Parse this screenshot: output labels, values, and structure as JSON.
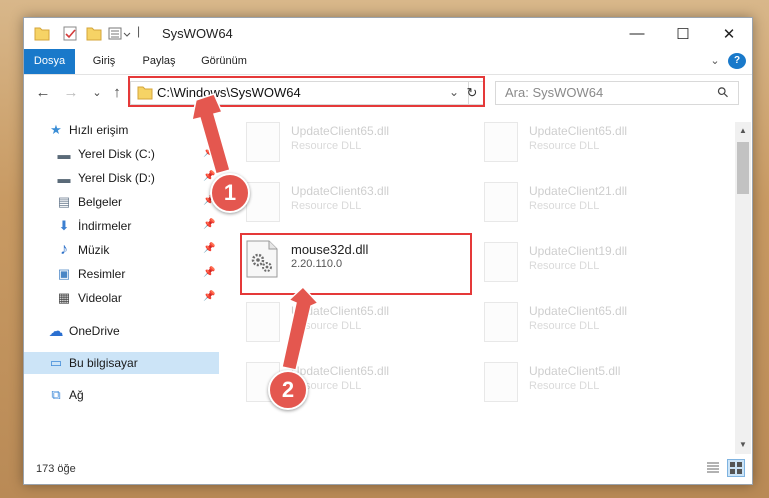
{
  "window": {
    "title": "SysWOW64",
    "minimize_glyph": "—",
    "maximize_glyph": "☐",
    "close_glyph": "✕"
  },
  "ribbon": {
    "tabs": [
      "Dosya",
      "Giriş",
      "Paylaş",
      "Görünüm"
    ],
    "collapse_glyph": "⌄",
    "help_glyph": "?"
  },
  "navigation": {
    "back_glyph": "←",
    "forward_glyph": "→",
    "recent_glyph": "⌄",
    "up_glyph": "↑",
    "address": "C:\\Windows\\SysWOW64",
    "address_dropdown_glyph": "⌄",
    "refresh_glyph": "↻",
    "search_placeholder": "Ara: SysWOW64",
    "search_glyph": "⚲"
  },
  "sidebar": {
    "items": [
      {
        "label": "Hızlı erişim",
        "icon": "star-icon",
        "glyph": "★",
        "color": "#3b8ed6"
      },
      {
        "label": "Yerel Disk (C:)",
        "icon": "drive-icon",
        "glyph": "▬",
        "color": "#5a6a78",
        "pin": "📌"
      },
      {
        "label": "Yerel Disk (D:)",
        "icon": "drive-icon",
        "glyph": "▬",
        "color": "#5a6a78",
        "pin": "📌"
      },
      {
        "label": "Belgeler",
        "icon": "documents-icon",
        "glyph": "▤",
        "color": "#6b7c8f",
        "pin": "📌"
      },
      {
        "label": "İndirmeler",
        "icon": "download-icon",
        "glyph": "⬇",
        "color": "#3b7fd1",
        "pin": "📌"
      },
      {
        "label": "Müzik",
        "icon": "music-icon",
        "glyph": "♪",
        "color": "#2f72c9",
        "pin": "📌"
      },
      {
        "label": "Resimler",
        "icon": "pictures-icon",
        "glyph": "▣",
        "color": "#4a86c5",
        "pin": "📌"
      },
      {
        "label": "Videolar",
        "icon": "videos-icon",
        "glyph": "▦",
        "color": "#444",
        "pin": "📌"
      },
      {
        "label": "OneDrive",
        "icon": "cloud-icon",
        "glyph": "☁",
        "color": "#2a6fd0"
      },
      {
        "label": "Bu bilgisayar",
        "icon": "computer-icon",
        "glyph": "▭",
        "color": "#3d89d8"
      },
      {
        "label": "Ağ",
        "icon": "network-icon",
        "glyph": "⧉",
        "color": "#3d89d8"
      }
    ]
  },
  "files": [
    {
      "name": "UpdateClient65.dll",
      "desc": "Resource DLL"
    },
    {
      "name": "UpdateClient65.dll",
      "desc": "Resource DLL"
    },
    {
      "name": "UpdateClient63.dll",
      "desc": "Resource DLL"
    },
    {
      "name": "UpdateClient21.dll",
      "desc": "Resource DLL"
    },
    {
      "name": "mouse32d.dll",
      "desc": "2.20.110.0"
    },
    {
      "name": "UpdateClient19.dll",
      "desc": "Resource DLL"
    },
    {
      "name": "UpdateClient65.dll",
      "desc": "Resource DLL"
    },
    {
      "name": "UpdateClient65.dll",
      "desc": "Resource DLL"
    },
    {
      "name": "UpdateClient65.dll",
      "desc": "Resource DLL"
    },
    {
      "name": "UpdateClient5.dll",
      "desc": "Resource DLL"
    }
  ],
  "status": {
    "item_count": "173 öğe"
  },
  "annotations": {
    "marker1": "1",
    "marker2": "2",
    "color": "#e53939"
  }
}
